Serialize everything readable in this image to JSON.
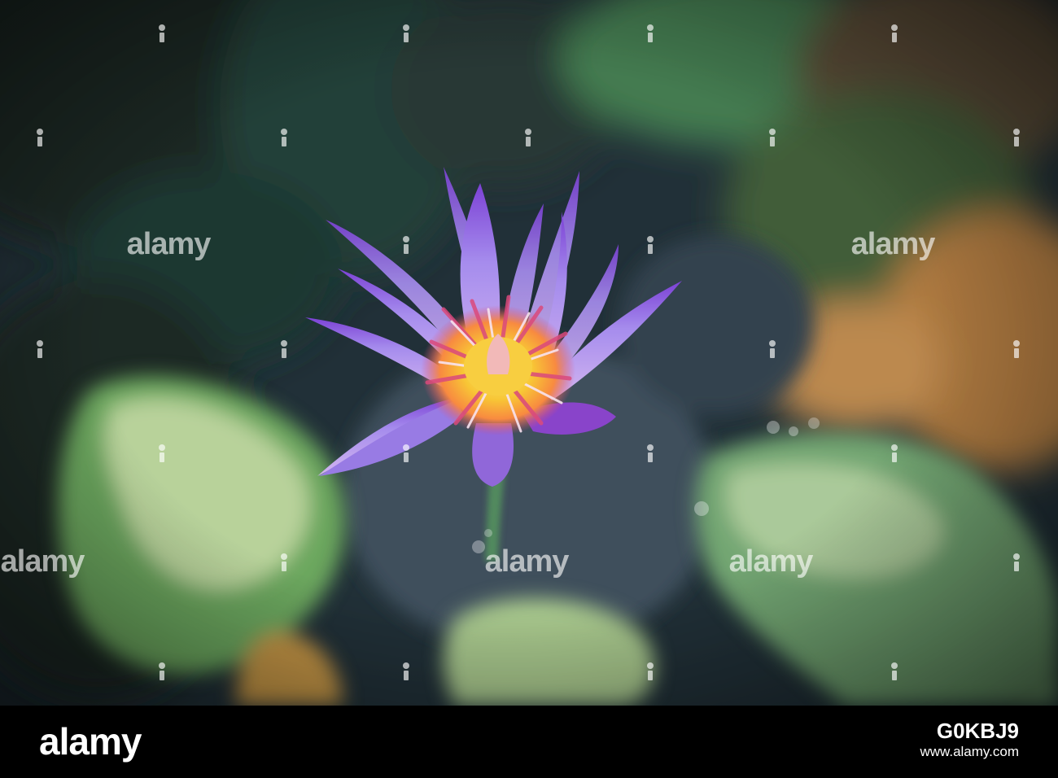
{
  "watermark": {
    "text": "alamy"
  },
  "footer": {
    "logo": "alamy",
    "image_id": "G0KBJ9",
    "site": "www.alamy.com"
  },
  "colors": {
    "petal": "#a98bf0",
    "petal_tip": "#7a39d6",
    "flower_center": "#ffd23a",
    "stamen_red": "#e0457a",
    "water": "#2a3b46",
    "lily_pad": "#5bb45a"
  }
}
